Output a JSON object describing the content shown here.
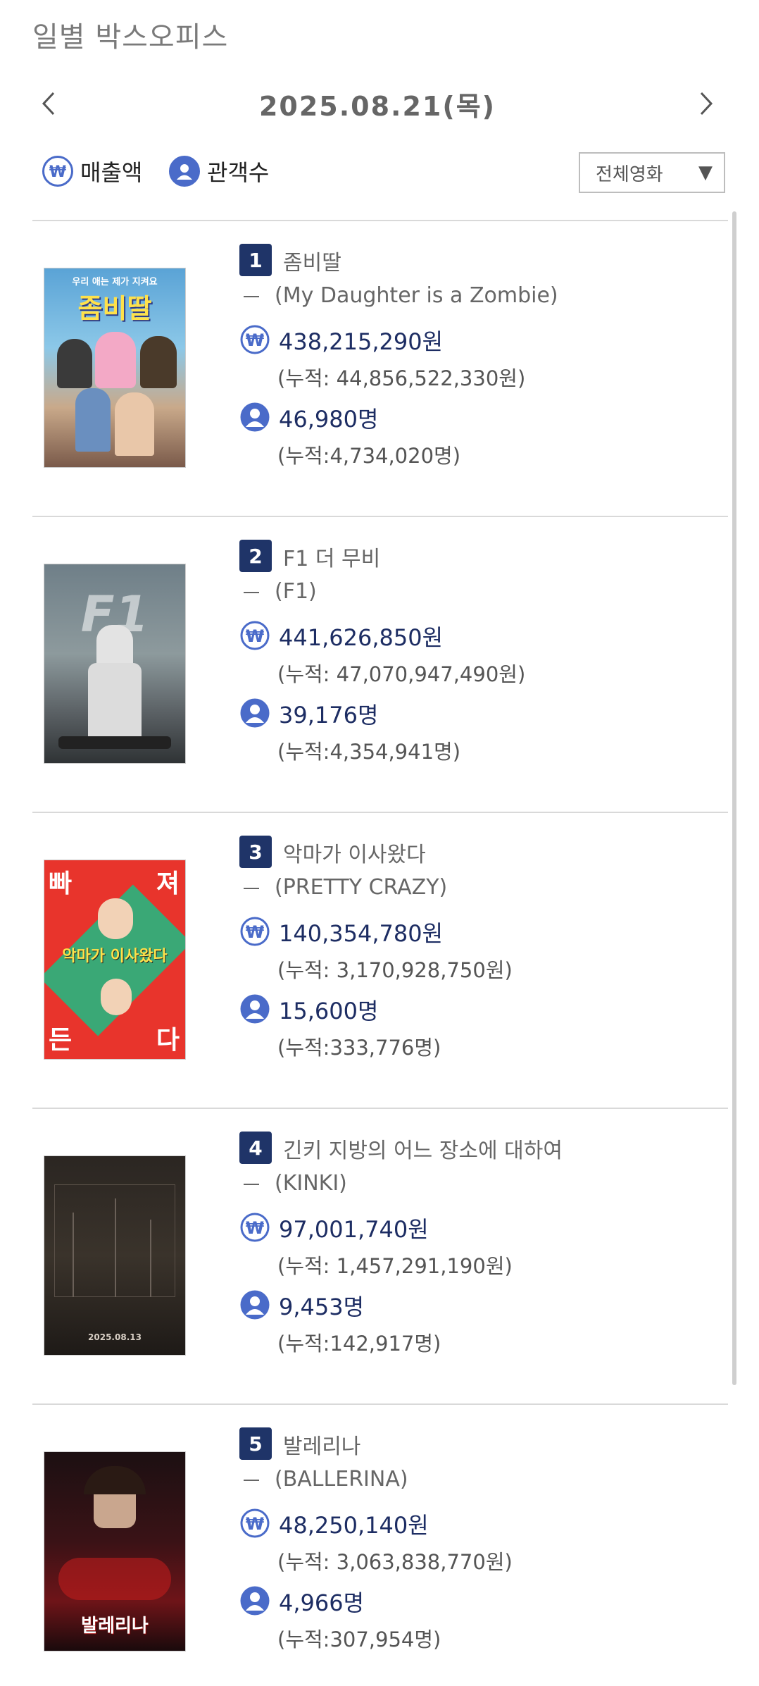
{
  "page": {
    "title": "일별 박스오피스"
  },
  "date_nav": {
    "date": "2025.08.21(목)"
  },
  "legend": {
    "sales_label": "매출액",
    "audience_label": "관객수"
  },
  "filter": {
    "selected": "전체영화"
  },
  "colors": {
    "accent": "#1f3468",
    "icon_blue": "#4a6bc9",
    "value_navy": "#1d2d63"
  },
  "movies": [
    {
      "rank": "1",
      "title_ko": "좀비딸",
      "title_en": "(My Daughter is a Zombie)",
      "sales": "438,215,290원",
      "sales_cum": "(누적: 44,856,522,330원)",
      "audience": "46,980명",
      "audience_cum": "(누적:4,734,020명)",
      "poster_text": "좀비딸",
      "poster_top": "우리 애는 제가 지켜요"
    },
    {
      "rank": "2",
      "title_ko": "F1 더 무비",
      "title_en": "(F1)",
      "sales": "441,626,850원",
      "sales_cum": "(누적: 47,070,947,490원)",
      "audience": "39,176명",
      "audience_cum": "(누적:4,354,941명)",
      "poster_text": "F1"
    },
    {
      "rank": "3",
      "title_ko": "악마가 이사왔다",
      "title_en": "(PRETTY CRAZY)",
      "sales": "140,354,780원",
      "sales_cum": "(누적: 3,170,928,750원)",
      "audience": "15,600명",
      "audience_cum": "(누적:333,776명)",
      "poster_corner_tl": "빠",
      "poster_corner_tr": "져",
      "poster_corner_bl": "든",
      "poster_corner_br": "다",
      "poster_text": "악마가 이사왔다"
    },
    {
      "rank": "4",
      "title_ko": "긴키 지방의 어느 장소에 대하여",
      "title_en": "(KINKI)",
      "sales": "97,001,740원",
      "sales_cum": "(누적: 1,457,291,190원)",
      "audience": "9,453명",
      "audience_cum": "(누적:142,917명)",
      "poster_text": "2025.08.13"
    },
    {
      "rank": "5",
      "title_ko": "발레리나",
      "title_en": "(BALLERINA)",
      "sales": "48,250,140원",
      "sales_cum": "(누적: 3,063,838,770원)",
      "audience": "4,966명",
      "audience_cum": "(누적:307,954명)",
      "poster_text": "발레리나"
    }
  ]
}
